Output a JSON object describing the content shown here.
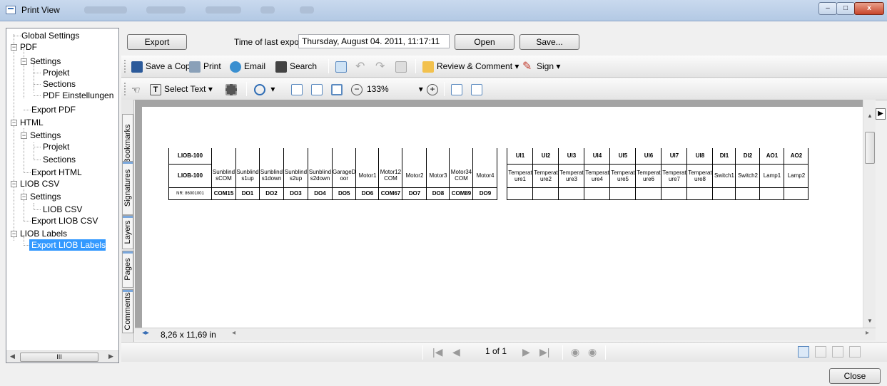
{
  "window": {
    "title": "Print View",
    "min": "–",
    "max": "□",
    "close": "x"
  },
  "tree": {
    "global": "Global Settings",
    "pdf": "PDF",
    "pdf_settings": "Settings",
    "projekt": "Projekt",
    "sections": "Sections",
    "pdf_einst": "PDF Einstellungen",
    "export_pdf": "Export PDF",
    "html": "HTML",
    "html_settings": "Settings",
    "html_projekt": "Projekt",
    "html_sections": "Sections",
    "export_html": "Export HTML",
    "liob_csv": "LIOB CSV",
    "csv_settings": "Settings",
    "csv_item": "LIOB CSV",
    "export_csv": "Export LIOB CSV",
    "liob_labels": "LIOB Labels",
    "export_labels": "Export LIOB Labels",
    "scroll_thumb": "III"
  },
  "top": {
    "export": "Export",
    "time_label": "Time of last export:",
    "time_value": "Thursday, August 04. 2011, 11:17:11",
    "open": "Open",
    "save": "Save..."
  },
  "toolbar1": {
    "save_copy": "Save a Copy",
    "print": "Print",
    "email": "Email",
    "search": "Search",
    "review": "Review & Comment",
    "sign": "Sign"
  },
  "toolbar2": {
    "select_text": "Select Text",
    "zoom": "133%"
  },
  "sidetabs": {
    "bookmarks": "Bookmarks",
    "signatures": "Signatures",
    "layers": "Layers",
    "pages": "Pages",
    "comments": "Comments"
  },
  "status": {
    "size": "8,26 x 11,69 in"
  },
  "pagenav": {
    "page": "1 of 1"
  },
  "close": "Close",
  "label": {
    "row1": [
      "LIOB-100",
      "",
      "",
      "",
      "",
      "",
      "",
      "",
      "",
      "",
      "",
      "",
      "",
      "",
      "UI1",
      "UI2",
      "UI3",
      "UI4",
      "UI5",
      "UI6",
      "UI7",
      "UI8",
      "DI1",
      "DI2",
      "AO1",
      "AO2"
    ],
    "row2": [
      "LIOB-100",
      "Sunblind sCOM",
      "Sunblind s1up",
      "Sunblind s1down",
      "Sunblind s2up",
      "Sunblind s2down",
      "GarageD oor",
      "Motor1",
      "Motor12 COM",
      "Motor2",
      "Motor3",
      "Motor34 COM",
      "Motor4",
      "",
      "Temperat ure1",
      "Temperat ure2",
      "Temperat ure3",
      "Temperat ure4",
      "Temperat ure5",
      "Temperat ure6",
      "Temperat ure7",
      "Temperat ure8",
      "Switch1",
      "Switch2",
      "Lamp1",
      "Lamp2"
    ],
    "row3": [
      "NR: 86001001",
      "COM15",
      "DO1",
      "DO2",
      "DO3",
      "DO4",
      "DO5",
      "DO6",
      "COM67",
      "DO7",
      "DO8",
      "COM89",
      "DO9",
      "",
      "",
      "",
      "",
      "",
      "",
      "",
      "",
      "",
      "",
      "",
      "",
      ""
    ]
  }
}
